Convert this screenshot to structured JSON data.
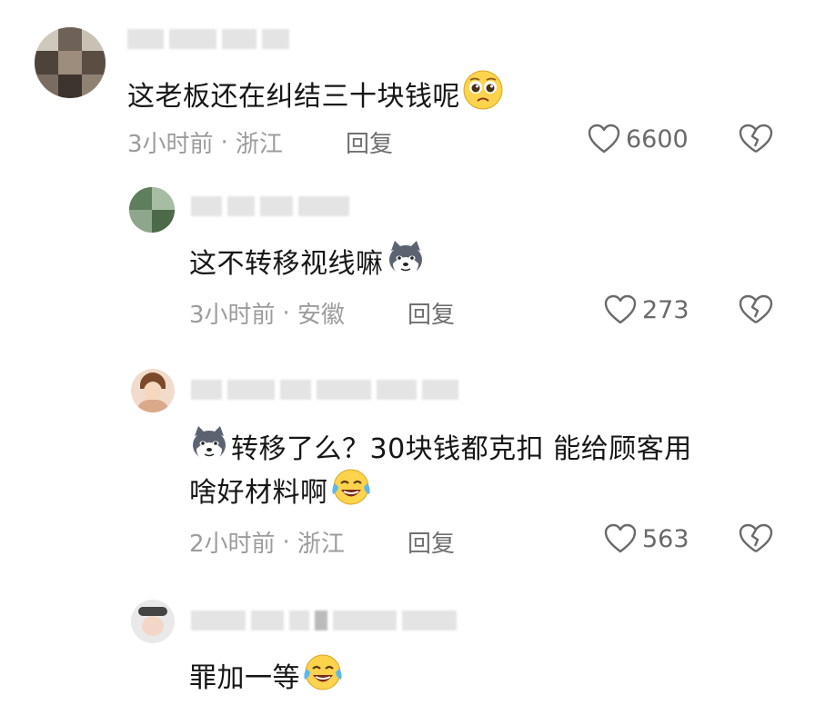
{
  "comments": [
    {
      "text": "这老板还在纠结三十块钱呢",
      "time": "3小时前",
      "location": "浙江",
      "reply": "回复",
      "likes": "6600",
      "emoji": "pleading-face"
    },
    {
      "text": "这不转移视线嘛",
      "time": "3小时前",
      "location": "安徽",
      "reply": "回复",
      "likes": "273",
      "emoji": "husky-face"
    },
    {
      "text_line1": "转移了么？30块钱都克扣 能给顾客用",
      "text_line2": "啥好材料啊",
      "time": "2小时前",
      "location": "浙江",
      "reply": "回复",
      "likes": "563",
      "emoji_lead": "husky-face",
      "emoji": "crying-laughing-face"
    },
    {
      "text": "罪加一等",
      "emoji": "crying-laughing-face"
    }
  ],
  "meta_separator": "·",
  "colors": {
    "text": "#161616",
    "meta": "#9c9c9c",
    "icon": "#6a6a6a"
  }
}
